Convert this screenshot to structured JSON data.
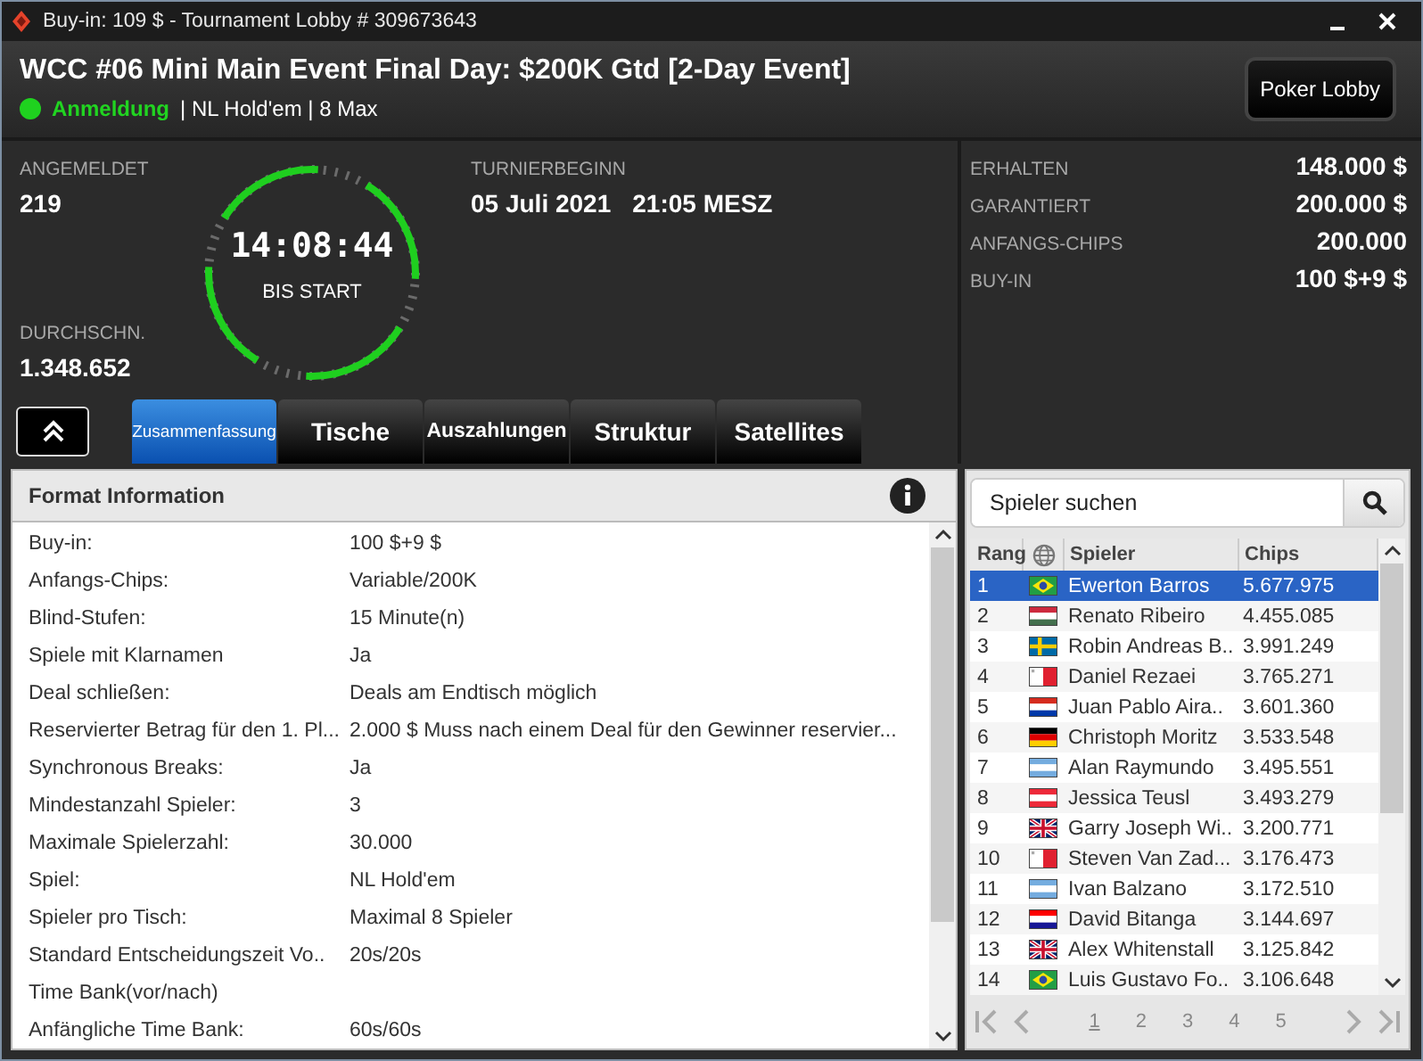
{
  "window": {
    "title": "Buy-in: 109 $ - Tournament Lobby # 309673643"
  },
  "header": {
    "title": "WCC #06 Mini Main Event Final Day: $200K Gtd [2-Day Event]",
    "status": "Anmeldung",
    "details": "| NL Hold'em | 8 Max",
    "lobby_button": "Poker Lobby"
  },
  "stats": {
    "registered_label": "ANGEMELDET",
    "registered": "219",
    "average_label": "DURCHSCHN.",
    "average": "1.348.652",
    "clock": "14:08:44",
    "clock_label": "BIS START",
    "start_label": "TURNIERBEGINN",
    "start_date": "05 Juli 2021",
    "start_time": "21:05 MESZ"
  },
  "prize": [
    {
      "label": "ERHALTEN",
      "value": "148.000 $"
    },
    {
      "label": "GARANTIERT",
      "value": "200.000 $"
    },
    {
      "label": "ANFANGS-CHIPS",
      "value": "200.000"
    },
    {
      "label": "BUY-IN",
      "value": "100 $+9 $"
    }
  ],
  "tabs": [
    {
      "label": "Zusammenfassung",
      "selected": true
    },
    {
      "label": "Tische",
      "selected": false
    },
    {
      "label": "Auszahlungen",
      "selected": false
    },
    {
      "label": "Struktur",
      "selected": false
    },
    {
      "label": "Satellites",
      "selected": false
    }
  ],
  "format_info": {
    "title": "Format Information",
    "rows": [
      {
        "label": "Buy-in:",
        "value": "100 $+9 $"
      },
      {
        "label": "Anfangs-Chips:",
        "value": "Variable/200K"
      },
      {
        "label": "Blind-Stufen:",
        "value": "15 Minute(n)"
      },
      {
        "label": "Spiele mit Klarnamen",
        "value": "Ja"
      },
      {
        "label": "Deal schließen:",
        "value": "Deals am Endtisch möglich"
      },
      {
        "label": "Reservierter Betrag für den 1. Pl...",
        "value": "2.000 $ Muss nach einem Deal für den Gewinner reservier..."
      },
      {
        "label": "Synchronous Breaks:",
        "value": "Ja"
      },
      {
        "label": "Mindestanzahl Spieler:",
        "value": "3"
      },
      {
        "label": "Maximale Spielerzahl:",
        "value": "30.000"
      },
      {
        "label": "Spiel:",
        "value": "NL Hold'em"
      },
      {
        "label": "Spieler pro Tisch:",
        "value": "Maximal 8 Spieler"
      },
      {
        "label": "Standard Entscheidungszeit Vo..",
        "value": "20s/20s"
      },
      {
        "label": "Time Bank(vor/nach)"
      },
      {
        "label": "Anfängliche Time Bank:",
        "value": "60s/60s"
      }
    ]
  },
  "players": {
    "search_placeholder": "Spieler suchen",
    "columns": [
      "Rang",
      "Spieler",
      "Chips"
    ],
    "rows": [
      {
        "rank": "1",
        "kind": "br",
        "name": "Ewerton Barros",
        "chips": "5.677.975",
        "selected": true
      },
      {
        "rank": "2",
        "kind": "hu",
        "name": "Renato Ribeiro",
        "chips": "4.455.085",
        "selected": false
      },
      {
        "rank": "3",
        "kind": "se",
        "name": "Robin Andreas B..",
        "chips": "3.991.249",
        "selected": false
      },
      {
        "rank": "4",
        "kind": "mt",
        "name": "Daniel Rezaei",
        "chips": "3.765.271",
        "selected": false
      },
      {
        "rank": "5",
        "kind": "py",
        "name": "Juan Pablo Aira..",
        "chips": "3.601.360",
        "selected": false
      },
      {
        "rank": "6",
        "kind": "de",
        "name": "Christoph Moritz",
        "chips": "3.533.548",
        "selected": false
      },
      {
        "rank": "7",
        "kind": "ar",
        "name": "Alan Raymundo",
        "chips": "3.495.551",
        "selected": false
      },
      {
        "rank": "8",
        "kind": "at",
        "name": "Jessica Teusl",
        "chips": "3.493.279",
        "selected": false
      },
      {
        "rank": "9",
        "kind": "gb",
        "name": "Garry Joseph Wi..",
        "chips": "3.200.771",
        "selected": false
      },
      {
        "rank": "10",
        "kind": "mt",
        "name": "Steven Van Zad...",
        "chips": "3.176.473",
        "selected": false
      },
      {
        "rank": "11",
        "kind": "ar",
        "name": "Ivan Balzano",
        "chips": "3.172.510",
        "selected": false
      },
      {
        "rank": "12",
        "kind": "hr",
        "name": "David Bitanga",
        "chips": "3.144.697",
        "selected": false
      },
      {
        "rank": "13",
        "kind": "gb",
        "name": "Alex Whitenstall",
        "chips": "3.125.842",
        "selected": false
      },
      {
        "rank": "14",
        "kind": "br",
        "name": "Luis Gustavo Fo..",
        "chips": "3.106.648",
        "selected": false
      }
    ],
    "pages": [
      {
        "label": "1",
        "selected": true
      },
      {
        "label": "2",
        "selected": false
      },
      {
        "label": "3",
        "selected": false
      },
      {
        "label": "4",
        "selected": false
      },
      {
        "label": "5",
        "selected": false
      }
    ]
  }
}
